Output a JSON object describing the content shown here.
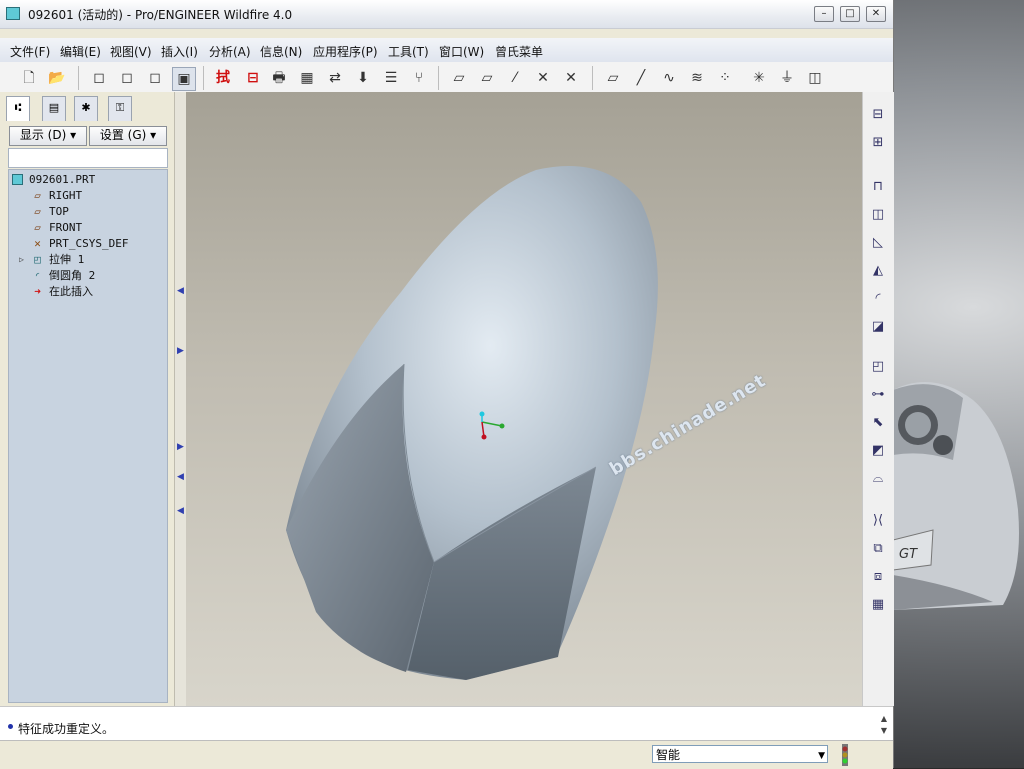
{
  "window": {
    "title": "092601 (活动的) - Pro/ENGINEER Wildfire 4.0",
    "minimize": "–",
    "maximize": "□",
    "close": "✕"
  },
  "menu": [
    "文件(F)",
    "编辑(E)",
    "视图(V)",
    "插入(I)",
    "分析(A)",
    "信息(N)",
    "应用程序(P)",
    "工具(T)",
    "窗口(W)",
    "曾氏菜单"
  ],
  "toolbar": {
    "icons": [
      "new-file-icon",
      "open-folder-icon",
      "wireframe-icon",
      "hidden-line-icon",
      "no-hidden-icon",
      "shading-icon",
      "extend-icon",
      "select-icon",
      "print-icon",
      "view-manager-icon",
      "orient-icon",
      "named-view-icon",
      "layers-icon",
      "model-tree-icon",
      "plane-display-icon",
      "axis-display-icon",
      "point-display-icon",
      "csys-display-icon",
      "datum-toggle-icon",
      "datum-plane-icon",
      "datum-axis-icon",
      "sketch-curve-icon",
      "datum-graph-icon",
      "datum-point-icon",
      "datum-csys-icon",
      "analysis-icon",
      "sketch-tool-icon"
    ],
    "extend_label": "拭"
  },
  "left_panel": {
    "tabs": [
      "model-tree-tab",
      "folder-browser-tab",
      "favorites-tab",
      "connections-tab"
    ],
    "show_button": "显示 (D) ▾",
    "settings_button": "设置 (G) ▾",
    "tree": [
      {
        "label": "092601.PRT",
        "icon": "part-icon",
        "indent": 0
      },
      {
        "label": "RIGHT",
        "icon": "datum-plane-icon",
        "indent": 1
      },
      {
        "label": "TOP",
        "icon": "datum-plane-icon",
        "indent": 1
      },
      {
        "label": "FRONT",
        "icon": "datum-plane-icon",
        "indent": 1
      },
      {
        "label": "PRT_CSYS_DEF",
        "icon": "csys-icon",
        "indent": 1
      },
      {
        "label": "拉伸 1",
        "icon": "extrude-icon",
        "indent": 1
      },
      {
        "label": "倒圆角 2",
        "icon": "round-icon",
        "indent": 1
      },
      {
        "label": "在此插入",
        "icon": "insert-here-arrow-icon",
        "indent": 1
      }
    ]
  },
  "viewport": {
    "watermark": "bbs.chinade.net"
  },
  "status": {
    "message": "特征成功重定义。",
    "filter_value": "智能"
  },
  "colors": {
    "viewport_top": "#a5a195",
    "viewport_bottom": "#d8d5cb",
    "model_light": "#dbe4ec",
    "model_dark": "#5c6670",
    "tree_bg": "#c8d3e0"
  }
}
